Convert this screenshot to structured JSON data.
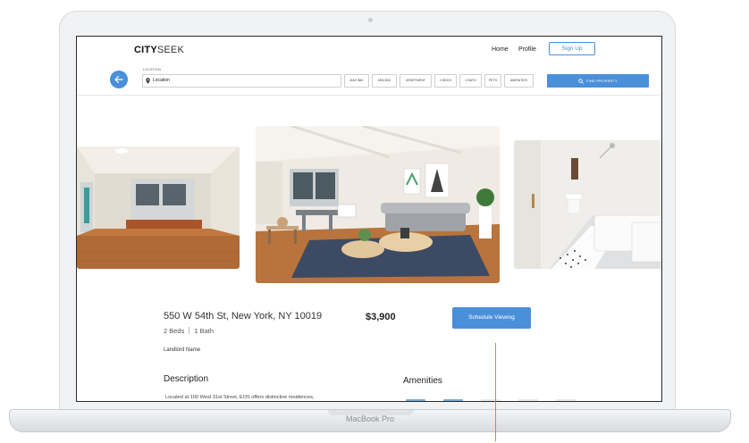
{
  "device": {
    "label": "MacBook Pro"
  },
  "header": {
    "logo_bold": "CITY",
    "logo_light": "SEEK",
    "nav": {
      "home": "Home",
      "profile": "Profile"
    },
    "signup_label": "Sign Up"
  },
  "search": {
    "location_label": "LOCATION",
    "location_value": "Location",
    "filters": [
      "MAX $6K",
      "MIN $3K",
      "APARTMENT",
      "2 BEDS",
      "1 BATH",
      "PETS",
      "AMENITIES"
    ],
    "find_label": "FIND PROPERTY"
  },
  "listing": {
    "address": "550 W 54th St, New York, NY 10019",
    "price": "$3,900",
    "schedule_label": "Schedule Viewing",
    "beds": "2 Beds",
    "baths": "1 Bath",
    "landlord": "Landlord Name",
    "description_title": "Description",
    "description_text": "Located at 100 West 31st Street, EOS offers distinctive residences,",
    "amenities_title": "Amenities"
  },
  "colors": {
    "accent": "#4a90d9",
    "annotation": "#f07a2a"
  },
  "icons": {
    "back": "arrow-left-icon",
    "pin": "map-pin-icon",
    "search": "search-icon"
  }
}
